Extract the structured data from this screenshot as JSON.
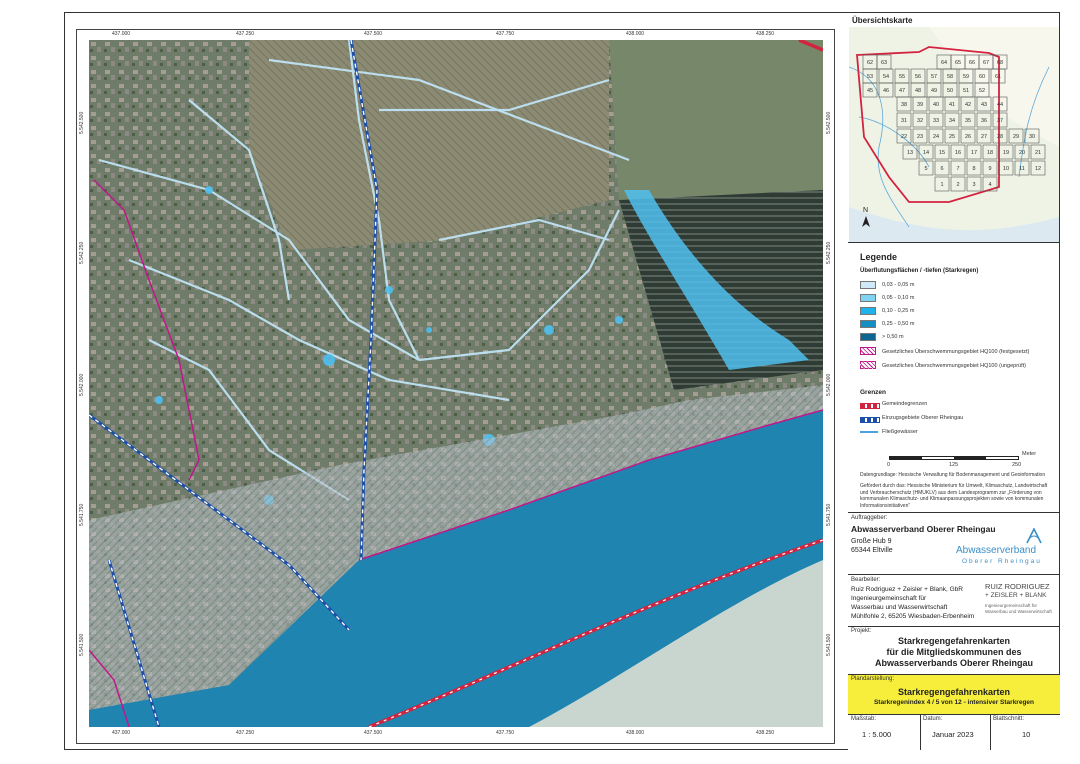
{
  "map": {
    "top_ticks": [
      "437.000",
      "437.250",
      "437.500",
      "437.750",
      "438.000",
      "438.250"
    ],
    "bottom_ticks": [
      "437.000",
      "437.250",
      "437.500",
      "437.750",
      "438.000",
      "438.250"
    ],
    "left_ticks": [
      "5.542.500",
      "5.542.250",
      "5.542.000",
      "5.541.750",
      "5.541.500"
    ],
    "right_ticks": [
      "5.542.500",
      "5.542.250",
      "5.542.000",
      "5.541.750",
      "5.541.500"
    ],
    "colors": {
      "river": "#1f84b0",
      "river_right": "#c9d6cf",
      "flood_light": "#bfe3f5",
      "flood_mid": "#4fc0ef",
      "flood_dark": "#1a9fd8",
      "boundary": "#d3233f",
      "area_boundary": "#1d4fa8",
      "stream": "#4aa3e0",
      "hq100": "#c0188a"
    }
  },
  "overview": {
    "title": "Übersichtskarte",
    "north": "N",
    "tiles": [
      "62",
      "63",
      "64",
      "65",
      "66",
      "67",
      "68",
      "53",
      "54",
      "55",
      "56",
      "57",
      "58",
      "59",
      "60",
      "61",
      "45",
      "46",
      "47",
      "48",
      "49",
      "50",
      "51",
      "52",
      "38",
      "39",
      "40",
      "41",
      "42",
      "43",
      "44",
      "31",
      "32",
      "33",
      "34",
      "35",
      "36",
      "37",
      "22",
      "23",
      "24",
      "25",
      "26",
      "27",
      "28",
      "29",
      "30",
      "13",
      "14",
      "15",
      "16",
      "17",
      "18",
      "19",
      "20",
      "21",
      "5",
      "6",
      "7",
      "8",
      "9",
      "10",
      "11",
      "12",
      "1",
      "2",
      "3",
      "4"
    ]
  },
  "legend": {
    "title": "Legende",
    "subtitle": "Überflutungsflächen / -tiefen (Starkregen)",
    "classes": [
      {
        "label": "0,03 - 0,05 m",
        "color": "#cfe9f7"
      },
      {
        "label": "0,05 - 0,10 m",
        "color": "#7fd3f3"
      },
      {
        "label": "0,10 - 0,25 m",
        "color": "#1fb3ec"
      },
      {
        "label": "0,25 - 0,50 m",
        "color": "#138fc4"
      },
      {
        "label": "> 0,50 m",
        "color": "#0d6592"
      }
    ],
    "hq_fixed": "Gesetzliches Überschwemmungsgebiet HQ100 (festgesetzt)",
    "hq_unchecked": "Gesetzliches Überschwemmungsgebiet HQ100 (ungeprüft)",
    "borders_title": "Grenzen",
    "border_municipal": "Gemeindegrenzen",
    "border_catchment": "Einzugsgebiete Oberer Rheingau",
    "border_stream": "Fließgewässer",
    "scale_unit": "Meter",
    "scale_0": "0",
    "scale_125": "125",
    "scale_250": "250",
    "source": "Datengrundlage: Hessische Verwaltung für Bodenmanagement und Geoinformation",
    "funding": "Gefördert durch das: Hessische Ministerium für Umwelt, Klimaschutz, Landwirtschaft und Verbraucherschutz (HMUKLV) aus dem Landesprogramm zur „Förderung von kommunalen Klimaschutz- und Klimaanpassungsprojekten sowie von kommunalen Informationsinitiativen“"
  },
  "client": {
    "label": "Auftraggeber:",
    "name": "Abwasserverband Oberer Rheingau",
    "street": "Große Hub 9",
    "city": "65344 Eltville",
    "logo_word1": "Abwasserverband",
    "logo_word2": "Oberer Rheingau"
  },
  "editor": {
    "label": "Bearbeiter:",
    "line1": "Ruiz Rodriguez + Zeisler + Blank, GbR",
    "line2": "Ingenieurgemeinschaft für",
    "line3": "Wasserbau und Wasserwirtschaft",
    "line4": "Mühlfohle 2, 65205 Wiesbaden-Erbenheim",
    "logo_line1": "RUIZ RODRIGUEZ",
    "logo_line2": "+ ZEISLER + BLANK",
    "logo_line3": "Ingenieurgemeinschaft für",
    "logo_line4": "Wasserbau und Wasserwirtschaft"
  },
  "project": {
    "label": "Projekt:",
    "line1": "Starkregengefahrenkarten",
    "line2": "für die Mitgliedskommunen des",
    "line3": "Abwasserverbands Oberer Rheingau"
  },
  "plan": {
    "label": "Plandarstellung:",
    "title": "Starkregengefahrenkarten",
    "subtitle": "Starkregenindex 4 / 5 von 12 - intensiver Starkregen"
  },
  "footer": {
    "scale_label": "Maßstab:",
    "scale_value": "1 : 5.000",
    "date_label": "Datum:",
    "date_value": "Januar 2023",
    "sheet_label": "Blattschnitt:",
    "sheet_value": "10"
  }
}
